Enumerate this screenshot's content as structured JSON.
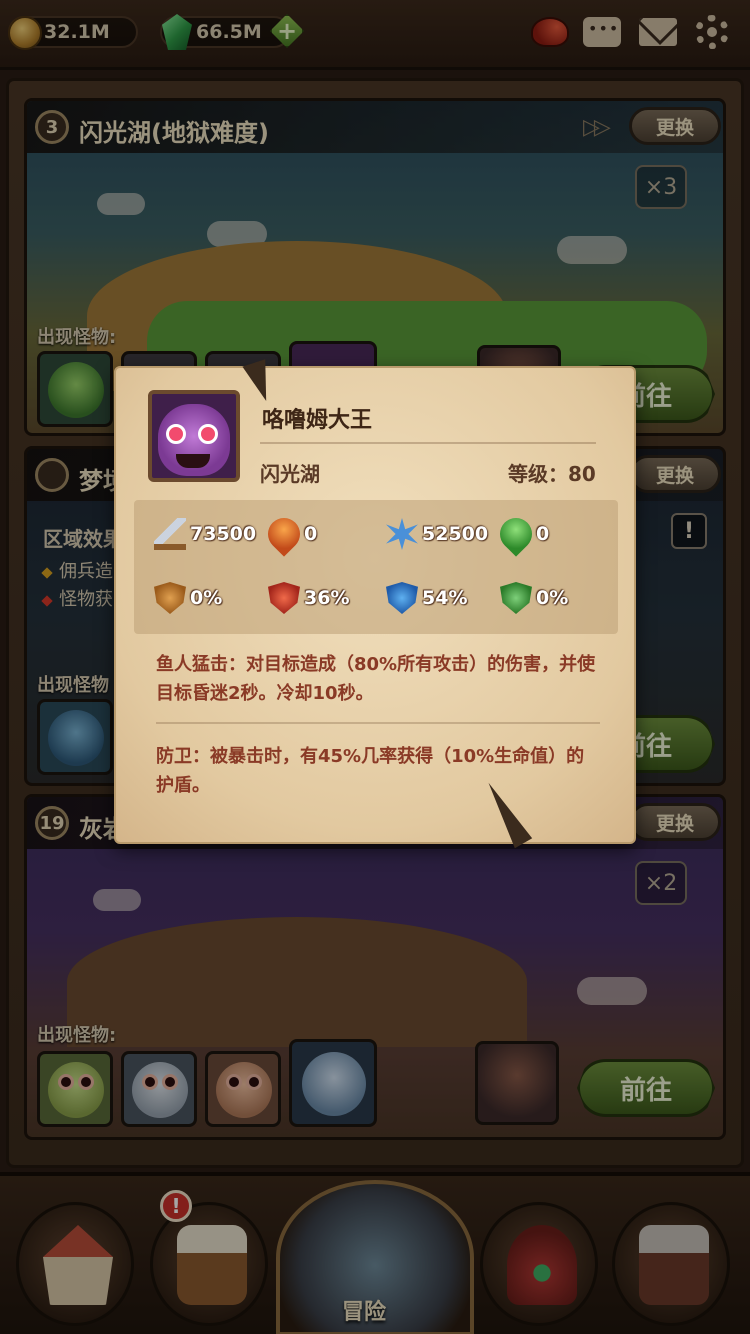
{
  "resources": {
    "gold": "32.1M",
    "gems": "66.5M",
    "plus_icon": "plus-icon"
  },
  "top_icons": [
    "horn-icon",
    "chat-icon",
    "mail-icon",
    "gear-icon"
  ],
  "stages": [
    {
      "level": "3",
      "title": "闪光湖(地狱难度)",
      "swap_label": "更换",
      "multiplier": "×3",
      "monsters_label": "出现怪物:",
      "go_label": "前往"
    },
    {
      "level": "",
      "title": "梦境",
      "swap_label": "更换",
      "alert": "!",
      "zone_effects_label": "区域效果",
      "zone_effects": [
        "佣兵造",
        "怪物获"
      ],
      "monsters_label": "出现怪物",
      "go_label": "前往"
    },
    {
      "level": "19",
      "title": "灰岩",
      "swap_label": "更换",
      "multiplier": "×2",
      "monsters_label": "出现怪物:",
      "go_label": "前往"
    }
  ],
  "popup": {
    "name": "咯噜姆大王",
    "map": "闪光湖",
    "level": "等级：80",
    "stats": {
      "attack": "73500",
      "fire": "0",
      "frost": "52500",
      "poison": "0",
      "physical_res": "0%",
      "fire_res": "36%",
      "frost_res": "54%",
      "poison_res": "0%"
    },
    "skills": [
      "鱼人猛击：对目标造成（80%所有攻击）的伤害，并使目标昏迷2秒。冷却10秒。",
      "防卫：被暴击时，有45%几率获得（10%生命值）的护盾。"
    ]
  },
  "bottom_nav": {
    "adventure_label": "冒险",
    "tavern_badge": "!"
  },
  "colors": {
    "accent_green": "#4a7d25",
    "parchment": "#e2c9a0",
    "skill_text": "#8a3a26"
  }
}
